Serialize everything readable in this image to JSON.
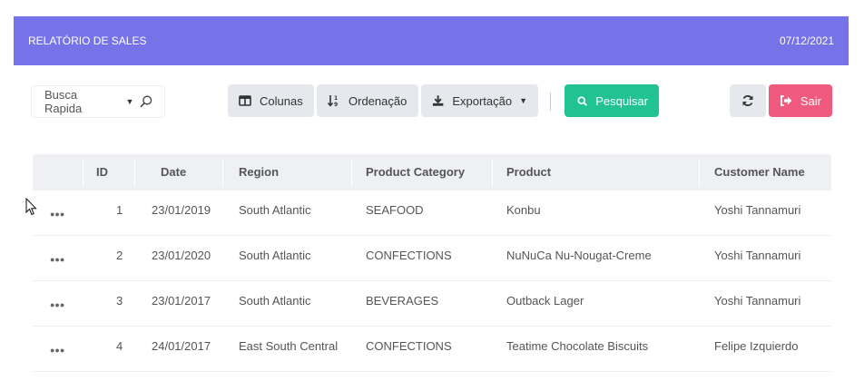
{
  "header": {
    "title": "RELATÓRIO DE SALES",
    "date": "07/12/2021"
  },
  "toolbar": {
    "search_label": "Busca Rapida",
    "columns_label": "Colunas",
    "sort_label": "Ordenação",
    "export_label": "Exportação",
    "search_button_label": "Pesquisar",
    "exit_label": "Sair"
  },
  "colors": {
    "header": "#7673e8",
    "search_button": "#21c395",
    "exit_button": "#f05a7e"
  },
  "icons": [
    "magnifier-icon",
    "columns-icon",
    "sort-icon",
    "download-icon",
    "search-icon",
    "refresh-icon",
    "logout-icon",
    "more-icon",
    "cursor-icon"
  ],
  "table": {
    "columns": [
      "ID",
      "Date",
      "Region",
      "Product Category",
      "Product",
      "Customer Name"
    ],
    "rows": [
      [
        "1",
        "23/01/2019",
        "South Atlantic",
        "SEAFOOD",
        "Konbu",
        "Yoshi Tannamuri"
      ],
      [
        "2",
        "23/01/2020",
        "South Atlantic",
        "CONFECTIONS",
        "NuNuCa Nu-Nougat-Creme",
        "Yoshi Tannamuri"
      ],
      [
        "3",
        "23/01/2017",
        "South Atlantic",
        "BEVERAGES",
        "Outback Lager",
        "Yoshi Tannamuri"
      ],
      [
        "4",
        "24/01/2017",
        "East South Central",
        "CONFECTIONS",
        "Teatime Chocolate Biscuits",
        "Felipe Izquierdo"
      ]
    ]
  }
}
